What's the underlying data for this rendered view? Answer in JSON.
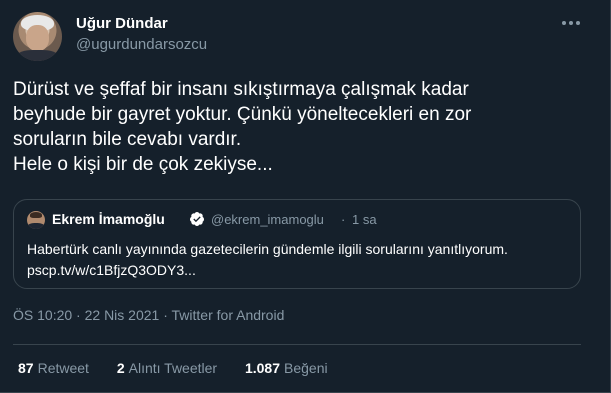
{
  "author": {
    "display_name": "Uğur Dündar",
    "handle": "@ugurdundarsozcu"
  },
  "tweet": {
    "lines": [
      "Dürüst ve şeffaf bir insanı sıkıştırmaya çalışmak kadar",
      "beyhude bir gayret yoktur. Çünkü yöneltecekleri en zor",
      "soruların bile cevabı vardır.",
      "Hele o kişi bir de çok zekiyse..."
    ]
  },
  "quoted_tweet": {
    "display_name": "Ekrem İmamoğlu",
    "handle": "@ekrem_imamoglu",
    "separator": "·",
    "time": "1 sa",
    "text": "Habertürk canlı yayınında gazetecilerin gündemle ilgili sorularını yanıtlıyorum.",
    "link": "pscp.tv/w/c1BfjzQ3ODY3..."
  },
  "meta": {
    "time": "ÖS 10:20",
    "separator": " · ",
    "date": "22 Nis 2021",
    "source": "Twitter for Android"
  },
  "stats": {
    "retweets_count": "87",
    "retweets_label": "Retweet",
    "quotes_count": "2",
    "quotes_label": "Alıntı Tweetler",
    "likes_count": "1.087",
    "likes_label": "Beğeni"
  },
  "icons": {
    "more": "more-horizontal-icon",
    "verified": "verified-badge-icon"
  },
  "colors": {
    "background": "#15202b",
    "secondary_text": "#8899a6",
    "border": "#38444d",
    "verified": "#ffffff"
  }
}
